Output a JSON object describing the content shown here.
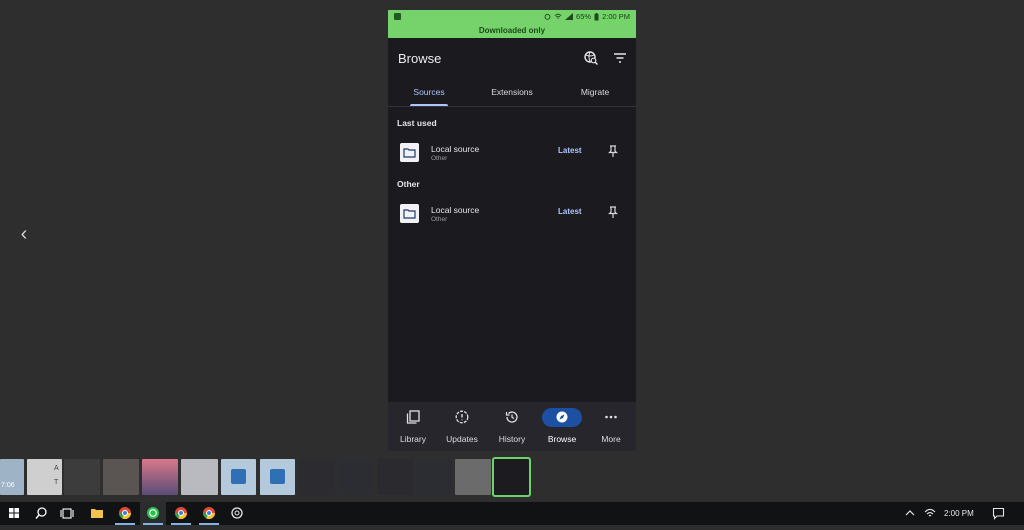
{
  "phone": {
    "status_bar": {
      "battery": "65%",
      "time": "2:00 PM"
    },
    "banner": "Downloaded only",
    "app_bar": {
      "title": "Browse",
      "icons": [
        "globe-search-icon",
        "filter-icon"
      ]
    },
    "tabs": [
      {
        "label": "Sources",
        "active": true
      },
      {
        "label": "Extensions",
        "active": false
      },
      {
        "label": "Migrate",
        "active": false
      }
    ],
    "sections": [
      {
        "heading": "Last used",
        "source": {
          "name": "Local source",
          "lang": "Other",
          "action": "Latest"
        }
      },
      {
        "heading": "Other",
        "source": {
          "name": "Local source",
          "lang": "Other",
          "action": "Latest"
        }
      }
    ],
    "bottom_nav": [
      {
        "label": "Library",
        "icon": "library-icon"
      },
      {
        "label": "Updates",
        "icon": "updates-icon"
      },
      {
        "label": "History",
        "icon": "history-icon"
      },
      {
        "label": "Browse",
        "icon": "explore-icon",
        "active": true
      },
      {
        "label": "More",
        "icon": "more-icon"
      }
    ]
  },
  "filmstrip_labels": [
    "A",
    "T",
    "7:06"
  ],
  "taskbar": {
    "apps": [
      "start-icon",
      "search-icon",
      "task-view-icon",
      "file-explorer-icon",
      "chrome-icon",
      "whatsapp-icon",
      "chrome-icon",
      "chrome-icon",
      "chatgpt-icon"
    ],
    "clock": "2:00 PM"
  },
  "colors": {
    "banner_green": "#76d36b",
    "accent_blue": "#aec6ff",
    "nav_pill": "#1d4fa3"
  }
}
